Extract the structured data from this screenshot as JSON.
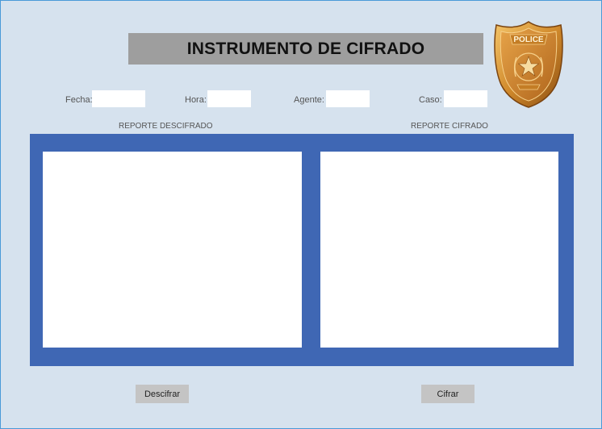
{
  "app": {
    "title": "INSTRUMENTO DE CIFRADO",
    "badge_icon": "police-badge",
    "badge_text": "POLICE"
  },
  "fields": {
    "fecha": {
      "label": "Fecha:",
      "value": ""
    },
    "hora": {
      "label": "Hora:",
      "value": ""
    },
    "agente": {
      "label": "Agente:",
      "value": ""
    },
    "caso": {
      "label": "Caso:",
      "value": ""
    }
  },
  "panels": {
    "descifrado_label": "REPORTE DESCIFRADO",
    "cifrado_label": "REPORTE CIFRADO"
  },
  "buttons": {
    "descifrar": "Descifrar",
    "cifrar": "Cifrar"
  },
  "colors": {
    "background": "#d6e2ee",
    "title_bar": "#9e9e9e",
    "frame_blue": "#3f67b4",
    "button_gray": "#c4c4c4",
    "badge_gold": "#d18a2c"
  }
}
